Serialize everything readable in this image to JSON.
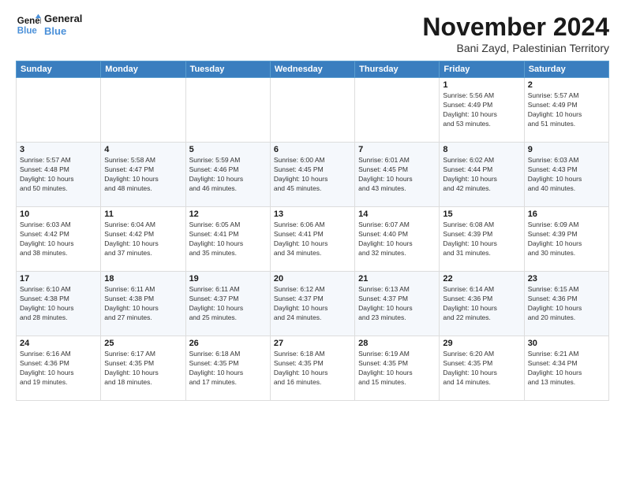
{
  "logo": {
    "line1": "General",
    "line2": "Blue"
  },
  "header": {
    "title": "November 2024",
    "subtitle": "Bani Zayd, Palestinian Territory"
  },
  "weekdays": [
    "Sunday",
    "Monday",
    "Tuesday",
    "Wednesday",
    "Thursday",
    "Friday",
    "Saturday"
  ],
  "weeks": [
    [
      {
        "day": "",
        "info": ""
      },
      {
        "day": "",
        "info": ""
      },
      {
        "day": "",
        "info": ""
      },
      {
        "day": "",
        "info": ""
      },
      {
        "day": "",
        "info": ""
      },
      {
        "day": "1",
        "info": "Sunrise: 5:56 AM\nSunset: 4:49 PM\nDaylight: 10 hours\nand 53 minutes."
      },
      {
        "day": "2",
        "info": "Sunrise: 5:57 AM\nSunset: 4:49 PM\nDaylight: 10 hours\nand 51 minutes."
      }
    ],
    [
      {
        "day": "3",
        "info": "Sunrise: 5:57 AM\nSunset: 4:48 PM\nDaylight: 10 hours\nand 50 minutes."
      },
      {
        "day": "4",
        "info": "Sunrise: 5:58 AM\nSunset: 4:47 PM\nDaylight: 10 hours\nand 48 minutes."
      },
      {
        "day": "5",
        "info": "Sunrise: 5:59 AM\nSunset: 4:46 PM\nDaylight: 10 hours\nand 46 minutes."
      },
      {
        "day": "6",
        "info": "Sunrise: 6:00 AM\nSunset: 4:45 PM\nDaylight: 10 hours\nand 45 minutes."
      },
      {
        "day": "7",
        "info": "Sunrise: 6:01 AM\nSunset: 4:45 PM\nDaylight: 10 hours\nand 43 minutes."
      },
      {
        "day": "8",
        "info": "Sunrise: 6:02 AM\nSunset: 4:44 PM\nDaylight: 10 hours\nand 42 minutes."
      },
      {
        "day": "9",
        "info": "Sunrise: 6:03 AM\nSunset: 4:43 PM\nDaylight: 10 hours\nand 40 minutes."
      }
    ],
    [
      {
        "day": "10",
        "info": "Sunrise: 6:03 AM\nSunset: 4:42 PM\nDaylight: 10 hours\nand 38 minutes."
      },
      {
        "day": "11",
        "info": "Sunrise: 6:04 AM\nSunset: 4:42 PM\nDaylight: 10 hours\nand 37 minutes."
      },
      {
        "day": "12",
        "info": "Sunrise: 6:05 AM\nSunset: 4:41 PM\nDaylight: 10 hours\nand 35 minutes."
      },
      {
        "day": "13",
        "info": "Sunrise: 6:06 AM\nSunset: 4:41 PM\nDaylight: 10 hours\nand 34 minutes."
      },
      {
        "day": "14",
        "info": "Sunrise: 6:07 AM\nSunset: 4:40 PM\nDaylight: 10 hours\nand 32 minutes."
      },
      {
        "day": "15",
        "info": "Sunrise: 6:08 AM\nSunset: 4:39 PM\nDaylight: 10 hours\nand 31 minutes."
      },
      {
        "day": "16",
        "info": "Sunrise: 6:09 AM\nSunset: 4:39 PM\nDaylight: 10 hours\nand 30 minutes."
      }
    ],
    [
      {
        "day": "17",
        "info": "Sunrise: 6:10 AM\nSunset: 4:38 PM\nDaylight: 10 hours\nand 28 minutes."
      },
      {
        "day": "18",
        "info": "Sunrise: 6:11 AM\nSunset: 4:38 PM\nDaylight: 10 hours\nand 27 minutes."
      },
      {
        "day": "19",
        "info": "Sunrise: 6:11 AM\nSunset: 4:37 PM\nDaylight: 10 hours\nand 25 minutes."
      },
      {
        "day": "20",
        "info": "Sunrise: 6:12 AM\nSunset: 4:37 PM\nDaylight: 10 hours\nand 24 minutes."
      },
      {
        "day": "21",
        "info": "Sunrise: 6:13 AM\nSunset: 4:37 PM\nDaylight: 10 hours\nand 23 minutes."
      },
      {
        "day": "22",
        "info": "Sunrise: 6:14 AM\nSunset: 4:36 PM\nDaylight: 10 hours\nand 22 minutes."
      },
      {
        "day": "23",
        "info": "Sunrise: 6:15 AM\nSunset: 4:36 PM\nDaylight: 10 hours\nand 20 minutes."
      }
    ],
    [
      {
        "day": "24",
        "info": "Sunrise: 6:16 AM\nSunset: 4:36 PM\nDaylight: 10 hours\nand 19 minutes."
      },
      {
        "day": "25",
        "info": "Sunrise: 6:17 AM\nSunset: 4:35 PM\nDaylight: 10 hours\nand 18 minutes."
      },
      {
        "day": "26",
        "info": "Sunrise: 6:18 AM\nSunset: 4:35 PM\nDaylight: 10 hours\nand 17 minutes."
      },
      {
        "day": "27",
        "info": "Sunrise: 6:18 AM\nSunset: 4:35 PM\nDaylight: 10 hours\nand 16 minutes."
      },
      {
        "day": "28",
        "info": "Sunrise: 6:19 AM\nSunset: 4:35 PM\nDaylight: 10 hours\nand 15 minutes."
      },
      {
        "day": "29",
        "info": "Sunrise: 6:20 AM\nSunset: 4:35 PM\nDaylight: 10 hours\nand 14 minutes."
      },
      {
        "day": "30",
        "info": "Sunrise: 6:21 AM\nSunset: 4:34 PM\nDaylight: 10 hours\nand 13 minutes."
      }
    ]
  ]
}
